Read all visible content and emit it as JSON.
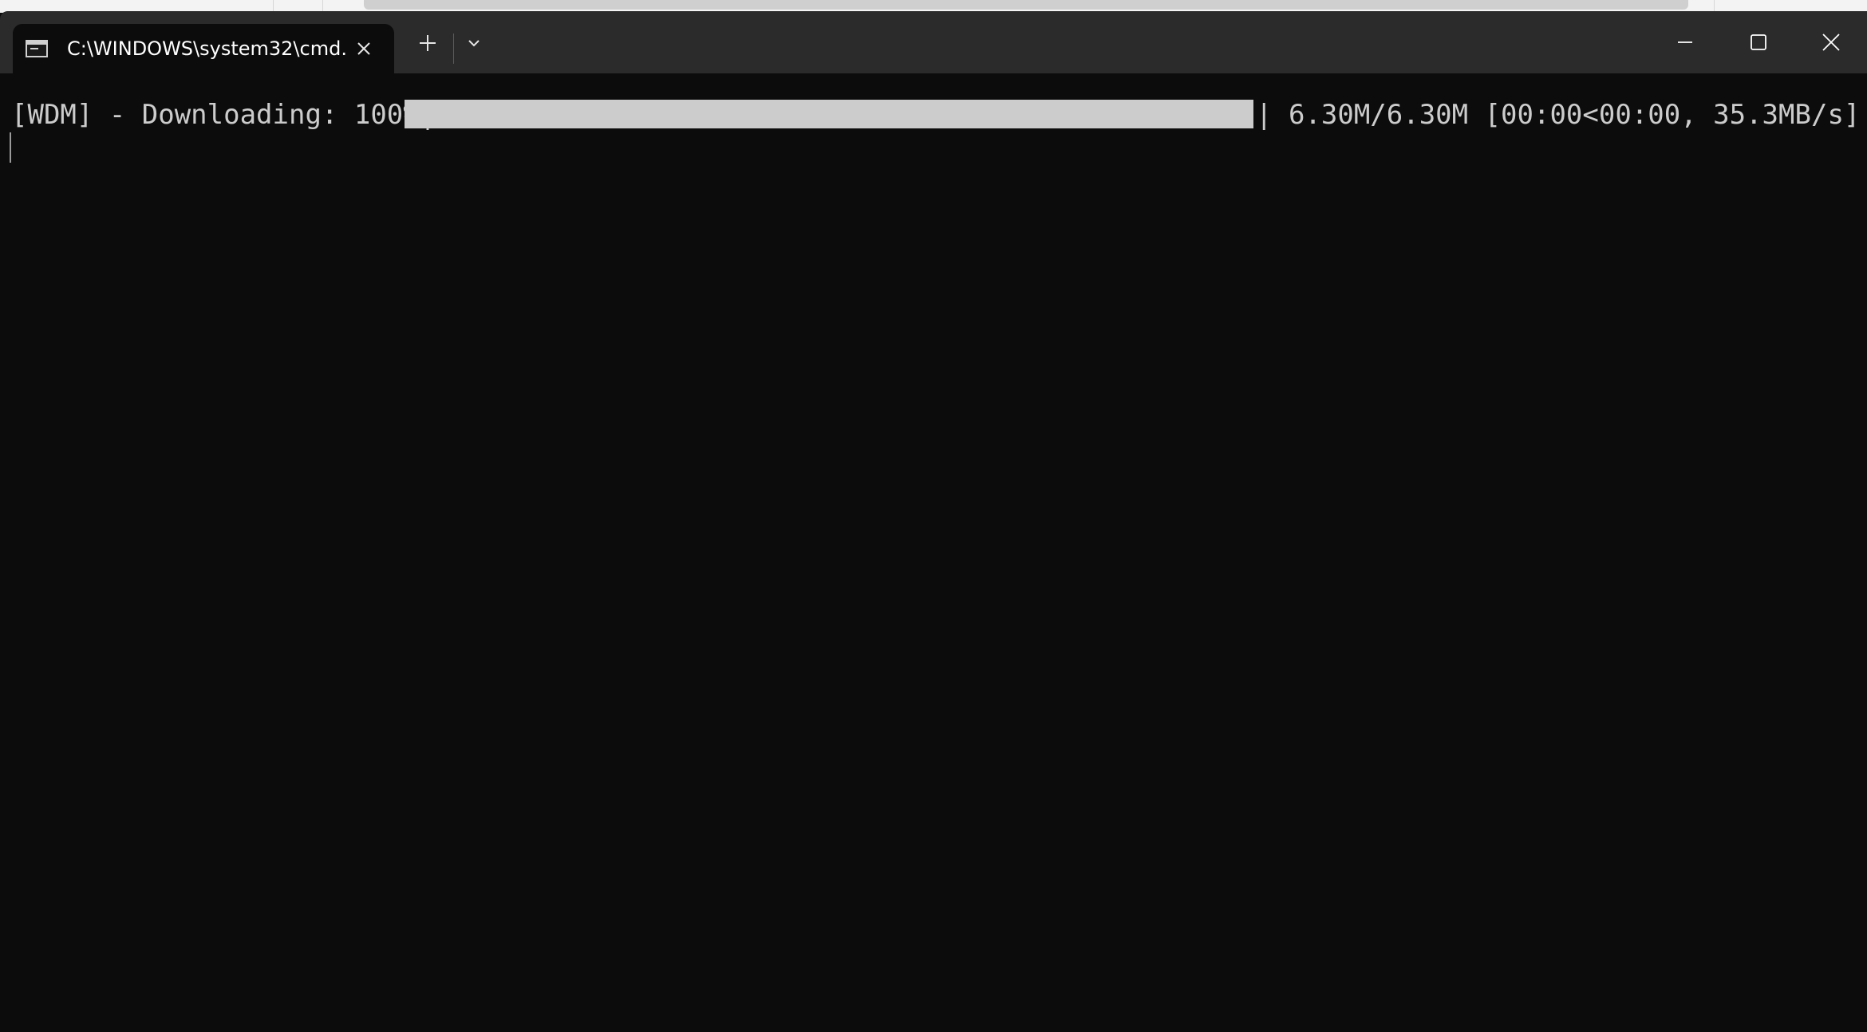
{
  "terminal": {
    "tab_title": "C:\\WINDOWS\\system32\\cmd.",
    "output_prefix": "[WDM] - Downloading: 100%|",
    "output_suffix": "| 6.30M/6.30M [00:00<00:00, 35.3MB/s]",
    "progress_fraction": 1.0
  },
  "icons": {
    "tab_icon": "cmd-icon",
    "tab_close": "close-icon",
    "new_tab": "plus-icon",
    "dropdown": "chevron-down-icon",
    "minimize": "minimize-icon",
    "maximize": "maximize-icon",
    "close": "close-icon"
  },
  "colors": {
    "background": "#0c0c0c",
    "titlebar": "#2b2b2b",
    "text": "#cccccc"
  }
}
